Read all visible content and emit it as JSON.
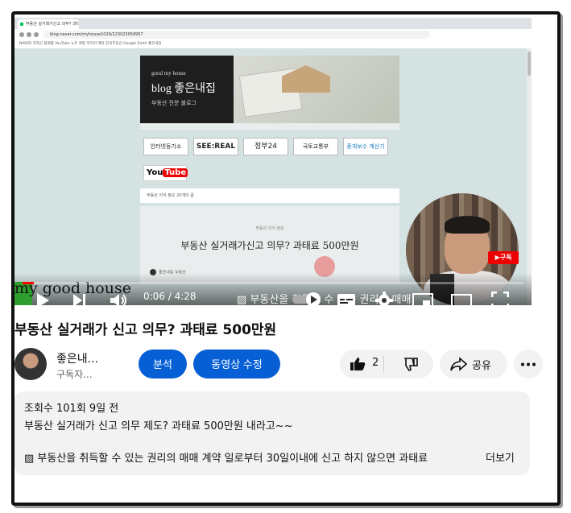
{
  "player": {
    "browser_tab_title": "부동산 실거래가신고 의무? 과티...",
    "browser_url": "blog.naver.com/myhouse1029/223023059957",
    "bookmarks": "NAVER   지자신 플랫폼   YouTube   노트   쿠팡   미디어 매일   한국부동산   Google Earth   좋은내집",
    "blog_banner": {
      "small": "good my house",
      "big": "blog 좋은내집",
      "sub": "부동산 전문 블로그"
    },
    "logo_links": [
      "인터넷등기소",
      "SEE:REAL",
      "정부24",
      "국토교통부",
      "중개보수 계산기"
    ],
    "youtube_logo": {
      "you": "You",
      "tube": "Tube"
    },
    "card_header": "부동산 지식 정보  20개의 글",
    "post_category": "부동산 지식 정보",
    "post_title": "부동산 실거래가신고 의무? 과태료 500만원",
    "post_meta": "좋은내집 부동산",
    "subscribe_badge": "▶구독",
    "watermark": "my good house",
    "time": "0:06 / 4:28",
    "progress_fraction": 0.022,
    "scroll_caption": "▨ 부동산을 취득할 수 있는 권리의 매매"
  },
  "video_title": "부동산 실거래가 신고 의무? 과태료 500만원",
  "channel": {
    "name": "좋은내...",
    "subscribers": "구독자..."
  },
  "buttons": {
    "analyze": "분석",
    "edit_video": "동영상 수정",
    "like_count": "2",
    "share": "공유"
  },
  "description": {
    "stats": "조회수 101회  9일 전",
    "line1": "부동산 실거래가 신고 의무 제도? 과태료 500만원 내라고~~",
    "line2": "▨ 부동산을 취득할 수 있는 권리의 매매 계약 일로부터 30일이내에 신고 하지 않으면 과태료",
    "more": "더보기"
  }
}
